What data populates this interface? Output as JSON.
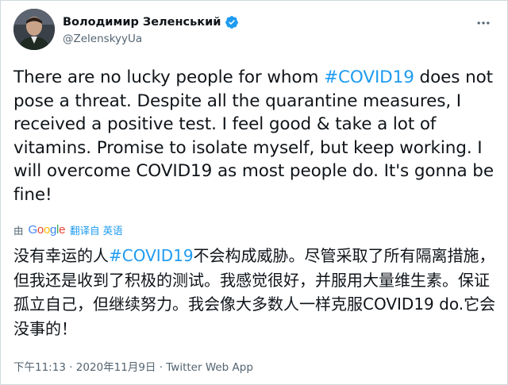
{
  "author": {
    "display_name": "Володимир Зеленський",
    "handle": "@ZelenskyyUa",
    "verified": true
  },
  "tweet": {
    "text_before": "There are no lucky people for whom ",
    "hashtag": "#COVID19",
    "text_after": " does not pose a threat. Despite all the quarantine measures, I received a positive test. I feel good & take a lot of vitamins. Promise to isolate myself, but keep working. I will overcome COVID19 as most people do. It's gonna be fine!"
  },
  "translation": {
    "by_label": "由",
    "provider_letters": [
      "G",
      "o",
      "o",
      "g",
      "l",
      "e"
    ],
    "link_label": "翻译自 英语",
    "text_before": "没有幸运的人",
    "hashtag": "#COVID19",
    "text_after": "不会构成威胁。尽管采取了所有隔离措施，但我还是收到了积极的测试。我感觉很好，并服用大量维生素。保证孤立自己，但继续努力。我会像大多数人一样克服COVID19 do.它会没事的！"
  },
  "meta": {
    "timestamp": "下午11:13 · 2020年11月9日 · Twitter Web App"
  },
  "colors": {
    "hashtag": "#1d9bf0",
    "verified": "#1d9bf0",
    "secondary_text": "#536471"
  },
  "icons": {
    "verified": "verified-badge-icon",
    "more": "more-dots-icon"
  }
}
